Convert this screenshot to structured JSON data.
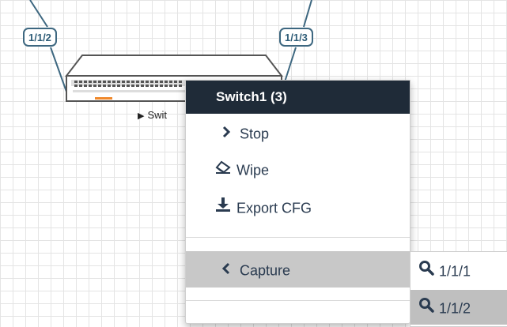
{
  "topology": {
    "links": [
      {
        "label": "1/1/2"
      },
      {
        "label": "1/1/3"
      }
    ],
    "node": {
      "label_visible": "Swit",
      "status_glyph": "▶"
    }
  },
  "context_menu": {
    "title": "Switch1 (3)",
    "items": [
      {
        "label": "Stop",
        "icon": "chevron-right-icon"
      },
      {
        "label": "Wipe",
        "icon": "eraser-icon"
      },
      {
        "label": "Export CFG",
        "icon": "download-icon"
      },
      {
        "label": "Capture",
        "icon": "chevron-left-icon",
        "selected": true
      }
    ]
  },
  "capture_submenu": {
    "items": [
      {
        "label": "1/1/1",
        "icon": "search-icon"
      },
      {
        "label": "1/1/2",
        "icon": "search-icon",
        "hovered": true
      }
    ]
  },
  "colors": {
    "menu_header_bg": "#1f2b38",
    "link_color": "#3d6780",
    "menu_text": "#2a3b50",
    "selected_bg": "#c8c8c8",
    "port_led": "#f0882a"
  }
}
